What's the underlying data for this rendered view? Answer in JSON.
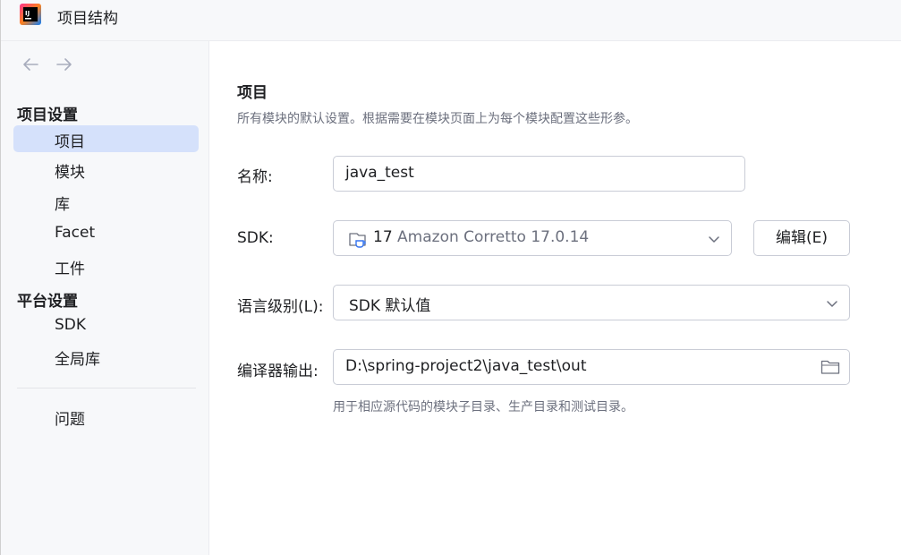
{
  "window": {
    "title": "项目结构"
  },
  "nav": {
    "back_icon": "arrow-left-icon",
    "forward_icon": "arrow-right-icon"
  },
  "sidebar": {
    "sections": [
      {
        "header": "项目设置",
        "items": [
          {
            "label": "项目",
            "selected": true
          },
          {
            "label": "模块"
          },
          {
            "label": "库"
          },
          {
            "label": "Facet"
          },
          {
            "label": "工件"
          }
        ]
      },
      {
        "header": "平台设置",
        "items": [
          {
            "label": "SDK"
          },
          {
            "label": "全局库"
          }
        ]
      }
    ],
    "problems": "问题"
  },
  "main": {
    "title": "项目",
    "description": "所有模块的默认设置。根据需要在模块页面上为每个模块配置这些形参。",
    "name_label": "名称:",
    "name_value": "java_test",
    "sdk_label": "SDK:",
    "sdk_version": "17",
    "sdk_name": "Amazon Corretto 17.0.14",
    "edit_button": "编辑(E)",
    "lang_label": "语言级别(L):",
    "lang_value": "SDK 默认值",
    "output_label": "编译器输出:",
    "output_value": "D:\\spring-project2\\java_test\\out",
    "output_hint": "用于相应源代码的模块子目录、生产目录和测试目录。"
  },
  "colors": {
    "selected_bg": "#d5e1fb",
    "muted_text": "#6c707e",
    "border": "#c9ccd6"
  }
}
